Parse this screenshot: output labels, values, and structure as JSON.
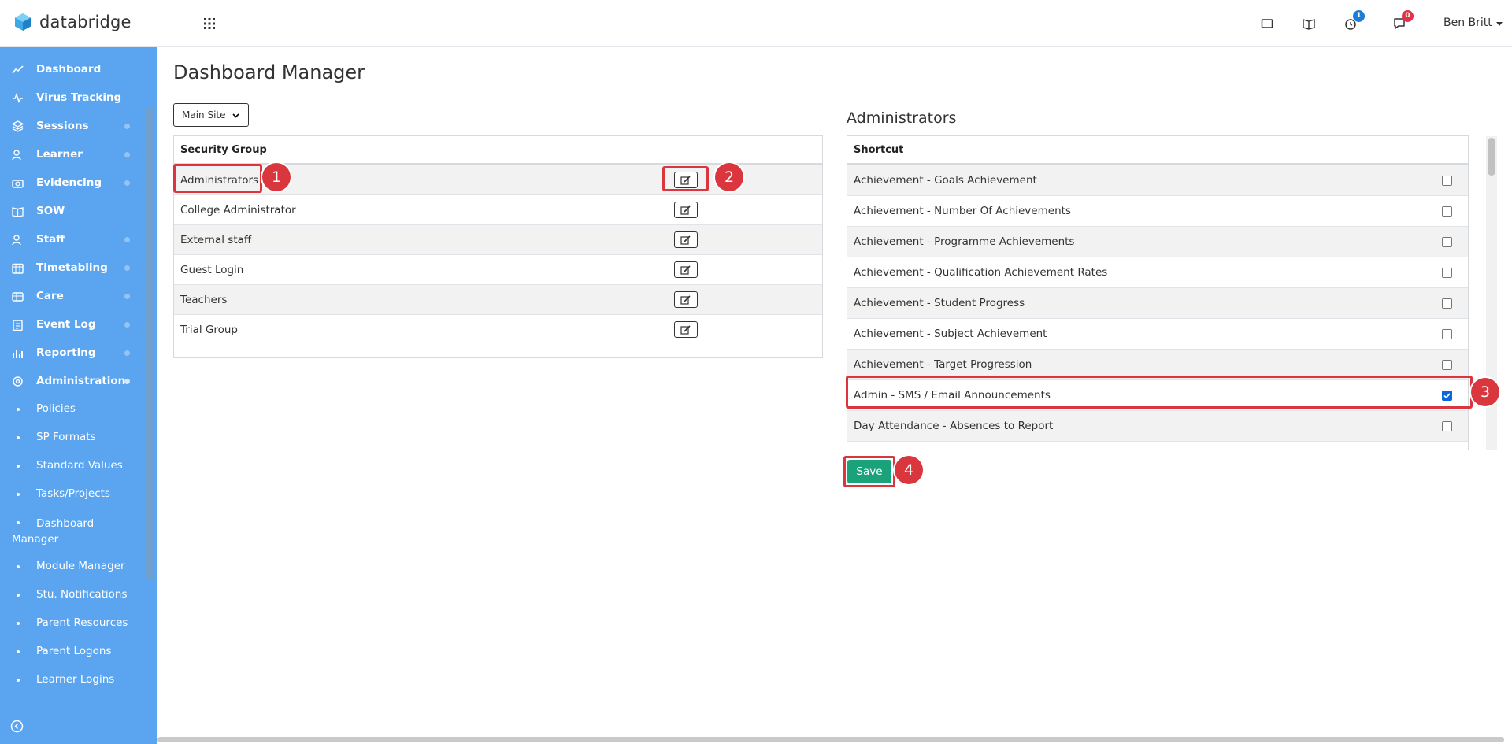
{
  "app": {
    "logo_text": "databridge",
    "user_name": "Ben Britt",
    "notifications_count": "1",
    "messages_count": "0"
  },
  "sidebar": {
    "items": [
      {
        "label": "Dashboard",
        "icon": "chart-line-icon"
      },
      {
        "label": "Virus Tracking",
        "icon": "pulse-icon"
      },
      {
        "label": "Sessions",
        "icon": "layers-icon"
      },
      {
        "label": "Learner",
        "icon": "users-icon"
      },
      {
        "label": "Evidencing",
        "icon": "camera-icon"
      },
      {
        "label": "SOW",
        "icon": "book-icon"
      },
      {
        "label": "Staff",
        "icon": "users-icon"
      },
      {
        "label": "Timetabling",
        "icon": "calendar-icon"
      },
      {
        "label": "Care",
        "icon": "id-card-icon"
      },
      {
        "label": "Event Log",
        "icon": "clipboard-icon"
      },
      {
        "label": "Reporting",
        "icon": "bar-chart-icon"
      },
      {
        "label": "Administration",
        "icon": "gear-icon"
      }
    ],
    "sub_items": [
      {
        "label": "Policies"
      },
      {
        "label": "SP Formats"
      },
      {
        "label": "Standard Values"
      },
      {
        "label": "Tasks/Projects"
      },
      {
        "label": "Dashboard Manager"
      },
      {
        "label": "Module Manager"
      },
      {
        "label": "Stu. Notifications"
      },
      {
        "label": "Parent Resources"
      },
      {
        "label": "Parent Logons"
      },
      {
        "label": "Learner Logins"
      }
    ]
  },
  "main": {
    "page_title": "Dashboard Manager",
    "site_select": {
      "value": "Main Site"
    },
    "security_group_table": {
      "header": "Security Group",
      "rows": [
        {
          "name": "Administrators"
        },
        {
          "name": "College Administrator"
        },
        {
          "name": "External staff"
        },
        {
          "name": "Guest Login"
        },
        {
          "name": "Teachers"
        },
        {
          "name": "Trial Group"
        }
      ]
    },
    "admin_panel": {
      "title": "Administrators",
      "header": "Shortcut",
      "rows": [
        {
          "name": "Achievement - Goals Achievement",
          "checked": false
        },
        {
          "name": "Achievement - Number Of Achievements",
          "checked": false
        },
        {
          "name": "Achievement - Programme Achievements",
          "checked": false
        },
        {
          "name": "Achievement - Qualification Achievement Rates",
          "checked": false
        },
        {
          "name": "Achievement - Student Progress",
          "checked": false
        },
        {
          "name": "Achievement - Subject Achievement",
          "checked": false
        },
        {
          "name": "Achievement - Target Progression",
          "checked": false
        },
        {
          "name": "Admin - SMS / Email Announcements",
          "checked": true
        },
        {
          "name": "Day Attendance - Absences to Report",
          "checked": false
        }
      ],
      "save_label": "Save"
    }
  },
  "annotations": [
    "1",
    "2",
    "3",
    "4"
  ],
  "colors": {
    "sidebar": "#5ba4ef",
    "save": "#1aa37a",
    "annotation": "#d9363e"
  }
}
